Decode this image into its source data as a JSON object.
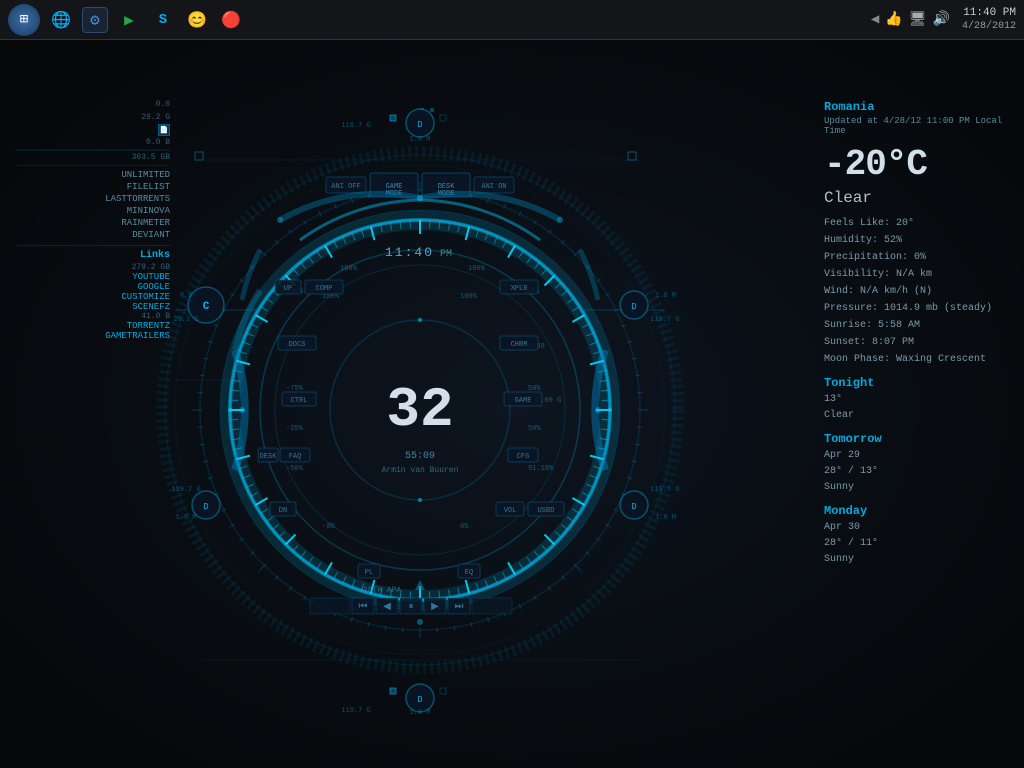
{
  "taskbar": {
    "time": "11:40 PM",
    "date": "4/28/2012",
    "start_label": "⊞",
    "icons": [
      "🔵",
      "🔵",
      "▶",
      "S",
      "😊",
      "🔴"
    ]
  },
  "hud": {
    "center_number": "32",
    "center_sub": "55:09",
    "center_artist": "Armin van Buuren",
    "time_display": "11:40",
    "time_pm": "PM",
    "buttons": {
      "ani_off": "ANI OFF",
      "game_mode": "GAME MODE",
      "desk_mode": "DESK MODE",
      "ani_on": "ANI ON",
      "up": "UP",
      "comp": "COMP",
      "docs": "DOCS",
      "ctrl": "CTRL",
      "faq": "FAQ",
      "dn": "DN",
      "desk": "DESK",
      "xplr": "XPLR",
      "chrm": "CHRM",
      "game": "GAME",
      "cfg": "CF6",
      "vol": "VOL",
      "usbd": "USBD",
      "pl": "PL",
      "eq": "EQ"
    },
    "track_date": "28TH APA",
    "indicators": {
      "c_left": "C",
      "d_right": "D",
      "d_left2": "D",
      "d_right2": "D",
      "d_top": "D",
      "d_bottom": "D"
    },
    "top_labels": {
      "left": "119.7 G",
      "right": "1.8 M"
    },
    "pct_labels": [
      "100%",
      "100%",
      "100%",
      "100%",
      "-75%",
      "75%",
      "75%",
      "75%",
      "-50%",
      "50%",
      "-25%",
      "25%",
      "-0%",
      "0%",
      "100%",
      "100%",
      "0%",
      "0%"
    ]
  },
  "sidebar": {
    "items": [
      {
        "label": "UNLIMITED",
        "type": "item"
      },
      {
        "label": "FILELIST",
        "type": "item"
      },
      {
        "label": "LASTTORRENTS",
        "type": "item"
      },
      {
        "label": "MININOVA",
        "type": "item"
      },
      {
        "label": "RAINMETER",
        "type": "item"
      },
      {
        "label": "DEVIANT",
        "type": "item"
      },
      {
        "label": "Links",
        "type": "section"
      },
      {
        "label": "YOUTUBE",
        "type": "link"
      },
      {
        "label": "GOOGLE",
        "type": "link"
      },
      {
        "label": "CUSTOMIZE",
        "type": "link"
      },
      {
        "label": "SCENEFZ",
        "type": "link"
      },
      {
        "label": "TORRENTZ",
        "type": "link"
      },
      {
        "label": "GAMETRAILERS",
        "type": "link"
      }
    ],
    "values": [
      {
        "label": "0.0",
        "pos": "top"
      },
      {
        "label": "29.2 G"
      },
      {
        "label": "0.0 B"
      },
      {
        "label": "363.5 GB"
      },
      {
        "label": "279.2 GB"
      },
      {
        "label": "41.0 B"
      }
    ]
  },
  "weather": {
    "location": "Romania",
    "updated": "Updated at 4/28/12 11:00 PM Local Time",
    "temp": "-20°C",
    "condition": "Clear",
    "details": {
      "humidity": "Humidity: 52%",
      "feels_like": "Feels Like: 20°",
      "precipitation": "Precipitation: 0%",
      "visibility": "Visibility: N/A km",
      "wind": "Wind: N/A km/h (N)",
      "pressure": "Pressure: 1014.9 mb (steady)",
      "sunrise": "Sunrise: 5:58 AM",
      "sunset": "Sunset: 8:07 PM",
      "moon": "Moon Phase: Waxing Crescent"
    },
    "tonight": {
      "title": "Tonight",
      "temp": "13°",
      "condition": "Clear"
    },
    "tomorrow": {
      "title": "Tomorrow",
      "date": "Apr 29",
      "temps": "28° / 13°",
      "condition": "Sunny"
    },
    "monday": {
      "title": "Monday",
      "date": "Apr 30",
      "temps": "28° / 11°",
      "condition": "Sunny"
    }
  }
}
